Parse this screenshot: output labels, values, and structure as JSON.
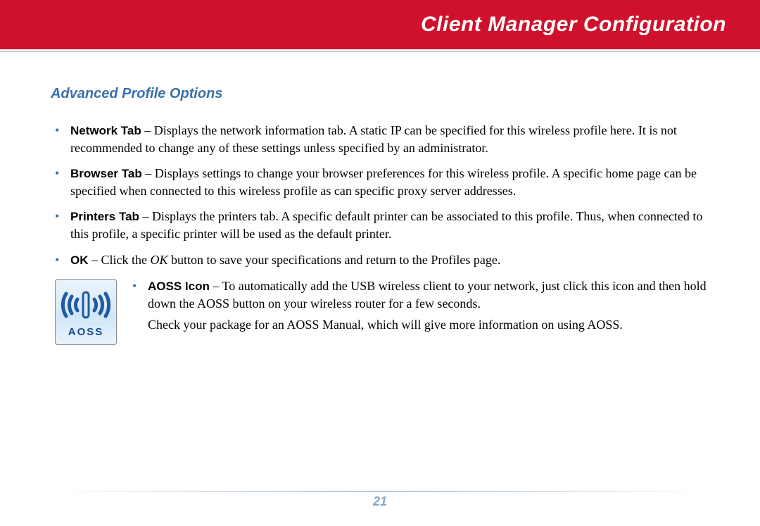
{
  "header": {
    "title": "Client Manager Configuration"
  },
  "section_title": "Advanced Profile Options",
  "options": {
    "network": {
      "label": "Network Tab",
      "text": " –  Displays the network information tab.  A static IP can be specified for this wireless profile here.  It is not recommended to change any of these settings unless specified by an administrator."
    },
    "browser": {
      "label": "Browser Tab",
      "text": " –  Displays settings to change your browser preferences for this wireless profile.  A specific home page can be specified when connected to this wireless profile as can specific proxy server addresses."
    },
    "printers": {
      "label": "Printers Tab",
      "text": " –  Displays the printers tab.  A specific default printer can be associated to this profile.  Thus, when connected to this profile, a specific printer will be used as the default printer."
    },
    "ok": {
      "label": "OK",
      "pre": " – Click the ",
      "ok_word": "OK",
      "post": " button to save your specifications and return to the Profiles page."
    },
    "aoss": {
      "label": "AOSS Icon",
      "text": " –  To automatically add the USB wireless client to your network, just click this icon and then hold down the AOSS button on your wireless router for a few seconds.",
      "follow": "Check your package for an AOSS Manual, which will give more information on using AOSS."
    }
  },
  "aoss_icon": {
    "caption": "AOSS"
  },
  "page_number": "21"
}
